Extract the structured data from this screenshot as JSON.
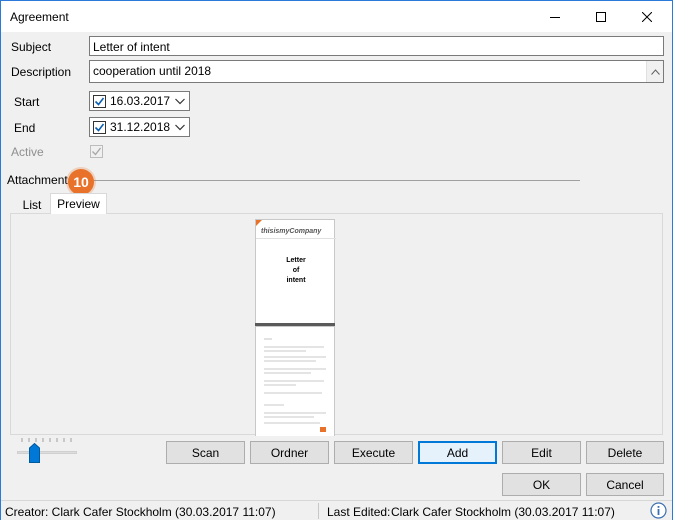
{
  "window": {
    "title": "Agreement"
  },
  "form": {
    "subject_label": "Subject",
    "subject_value": "Letter of intent",
    "description_label": "Description",
    "description_value": "cooperation until 2018",
    "start_label": "Start",
    "start_value": "16.03.2017",
    "end_label": "End",
    "end_value": "31.12.2018",
    "active_label": "Active",
    "attachments_label": "Attachments"
  },
  "annotation": {
    "badge": "10"
  },
  "tabs": [
    {
      "label": "List"
    },
    {
      "label": "Preview"
    }
  ],
  "preview": {
    "logo": "thisismyCompany",
    "doc_title_line1": "Letter",
    "doc_title_line2": "of",
    "doc_title_line3": "intent"
  },
  "buttons": {
    "scan": "Scan",
    "ordner": "Ordner",
    "execute": "Execute",
    "add": "Add",
    "edit": "Edit",
    "delete": "Delete",
    "ok": "OK",
    "cancel": "Cancel"
  },
  "status": {
    "creator": "Creator: Clark Cafer Stockholm (30.03.2017 11:07)",
    "last_edited_label": "Last Edited:",
    "last_edited_value": "Clark Cafer Stockholm (30.03.2017 11:07)"
  },
  "colors": {
    "accent": "#0078d7",
    "badge": "#e8722a",
    "window_border": "#2b79d8"
  },
  "icons": {
    "minimize": "minimize-icon",
    "maximize": "maximize-icon",
    "close": "close-icon",
    "info": "info-icon",
    "dropdown": "chevron-down-icon",
    "check": "check-icon"
  }
}
